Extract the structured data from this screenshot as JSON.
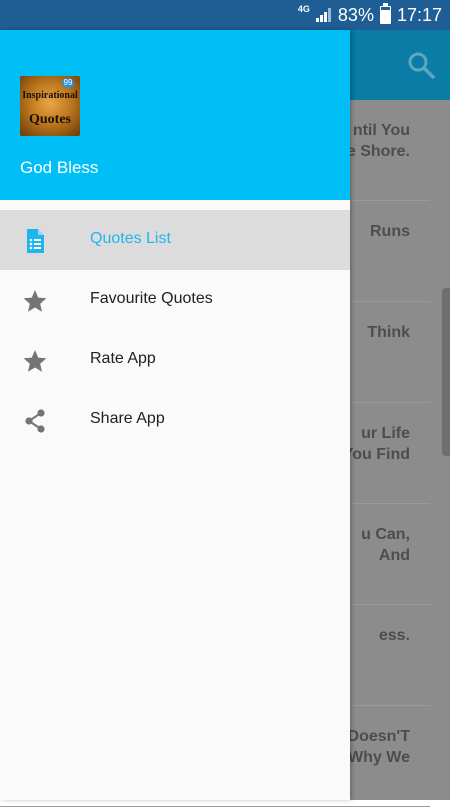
{
  "status_bar": {
    "network": "4G",
    "battery": "83%",
    "battery_level": 0.83,
    "time": "17:17"
  },
  "app_bar": {
    "search_icon": "search-icon"
  },
  "background_list": {
    "items": [
      {
        "text": "ntil You\ne Shore."
      },
      {
        "text": "Runs"
      },
      {
        "text": "Think"
      },
      {
        "text": "ur Life\nYou Find"
      },
      {
        "text": "u Can,\nAnd"
      },
      {
        "text": "ess."
      },
      {
        "text": "Doesn'T\nS Why We"
      }
    ]
  },
  "drawer": {
    "header": {
      "logo_text_top": "Inspirational",
      "logo_text_bottom": "Quotes",
      "logo_badge": "99",
      "subtitle": "God Bless"
    },
    "items": [
      {
        "label": "Quotes List",
        "icon": "document-icon",
        "active": true
      },
      {
        "label": "Favourite Quotes",
        "icon": "star-icon",
        "active": false
      },
      {
        "label": "Rate App",
        "icon": "star-icon",
        "active": false
      },
      {
        "label": "Share App",
        "icon": "share-icon",
        "active": false
      }
    ]
  },
  "colors": {
    "status_bar": "#1f5e94",
    "app_bar": "#0a7ca5",
    "drawer_header": "#00bff7",
    "active_accent": "#1fb6f0",
    "icon_gray": "#757575"
  }
}
